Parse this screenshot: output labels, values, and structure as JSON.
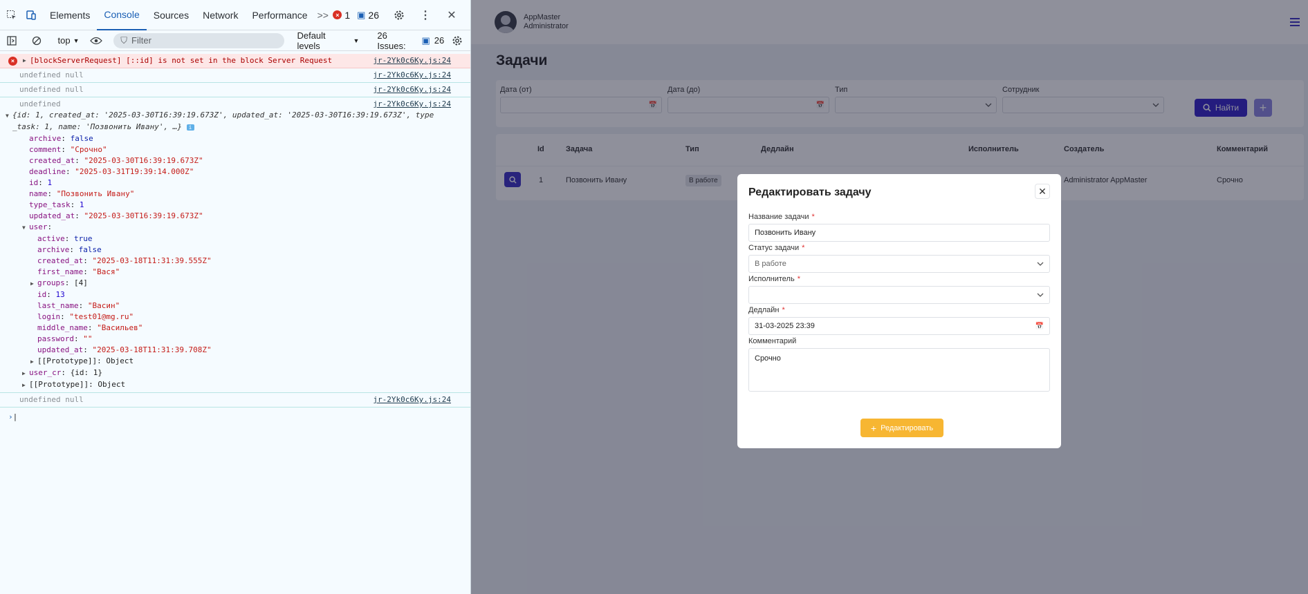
{
  "devtools": {
    "tabs": [
      "Elements",
      "Console",
      "Sources",
      "Network",
      "Performance"
    ],
    "more_tabs": ">>",
    "error_count": "1",
    "message_count": "26",
    "context": "top",
    "filter_placeholder": "Filter",
    "levels": "Default levels",
    "issues_label": "26 Issues:",
    "issues_count": "26",
    "console": {
      "error_text": "[blockServerRequest] [::id] is not set in the block Server Request",
      "source": "jr-2Yk0c6Ky.js:24",
      "undefined_null": "undefined null",
      "undefined": "undefined",
      "object_summary_1": "{id: 1, created_at: '2025-03-30T16:39:19.673Z', updated_at: '2025-03-30T16:39:19.673Z', type",
      "object_summary_2": "_task: 1, name: 'Позвонить Ивану', …}",
      "obj": [
        {
          "k": "archive",
          "v": "false",
          "t": "bool"
        },
        {
          "k": "comment",
          "v": "\"Срочно\"",
          "t": "str"
        },
        {
          "k": "created_at",
          "v": "\"2025-03-30T16:39:19.673Z\"",
          "t": "str"
        },
        {
          "k": "deadline",
          "v": "\"2025-03-31T19:39:14.000Z\"",
          "t": "str"
        },
        {
          "k": "id",
          "v": "1",
          "t": "num"
        },
        {
          "k": "name",
          "v": "\"Позвонить Ивану\"",
          "t": "str"
        },
        {
          "k": "type_task",
          "v": "1",
          "t": "num"
        },
        {
          "k": "updated_at",
          "v": "\"2025-03-30T16:39:19.673Z\"",
          "t": "str"
        }
      ],
      "user_key": "user",
      "user": [
        {
          "k": "active",
          "v": "true",
          "t": "bool"
        },
        {
          "k": "archive",
          "v": "false",
          "t": "bool"
        },
        {
          "k": "created_at",
          "v": "\"2025-03-18T11:31:39.555Z\"",
          "t": "str"
        },
        {
          "k": "first_name",
          "v": "\"Вася\"",
          "t": "str"
        },
        {
          "k": "groups",
          "v": "[4]",
          "t": "plain"
        },
        {
          "k": "id",
          "v": "13",
          "t": "num"
        },
        {
          "k": "last_name",
          "v": "\"Васин\"",
          "t": "str"
        },
        {
          "k": "login",
          "v": "\"test01@mg.ru\"",
          "t": "str"
        },
        {
          "k": "middle_name",
          "v": "\"Васильев\"",
          "t": "str"
        },
        {
          "k": "password",
          "v": "\"\"",
          "t": "str"
        },
        {
          "k": "updated_at",
          "v": "\"2025-03-18T11:31:39.708Z\"",
          "t": "str"
        }
      ],
      "prototype_label": "[[Prototype]]: Object",
      "user_cr_key": "user_cr",
      "user_cr_value": "{id: 1}"
    }
  },
  "app": {
    "user_name": "AppMaster",
    "user_role": "Administrator",
    "page_title": "Задачи",
    "filters": {
      "date_from": "Дата (от)",
      "date_to": "Дата (до)",
      "type": "Тип",
      "employee": "Сотрудник",
      "find_button": "Найти"
    },
    "table": {
      "headers": [
        "Id",
        "Задача",
        "Тип",
        "Дедлайн",
        "Исполнитель",
        "Создатель",
        "Комментарий"
      ],
      "row": {
        "id": "1",
        "task": "Позвонить Ивану",
        "type": "В работе",
        "creator": "Administrator AppMaster",
        "comment": "Срочно"
      }
    },
    "modal": {
      "title": "Редактировать задачу",
      "name_label": "Название задачи",
      "name_value": "Позвонить Ивану",
      "status_label": "Статус задачи",
      "status_value": "В работе",
      "assignee_label": "Исполнитель",
      "assignee_value": "",
      "deadline_label": "Дедлайн",
      "deadline_value": "31-03-2025 23:39",
      "comment_label": "Комментарий",
      "comment_value": "Срочно",
      "submit_label": "Редактировать",
      "required_mark": "*"
    }
  },
  "colors": {
    "primary": "#3321c7",
    "accent": "#f7b632",
    "error": "#d93025"
  }
}
